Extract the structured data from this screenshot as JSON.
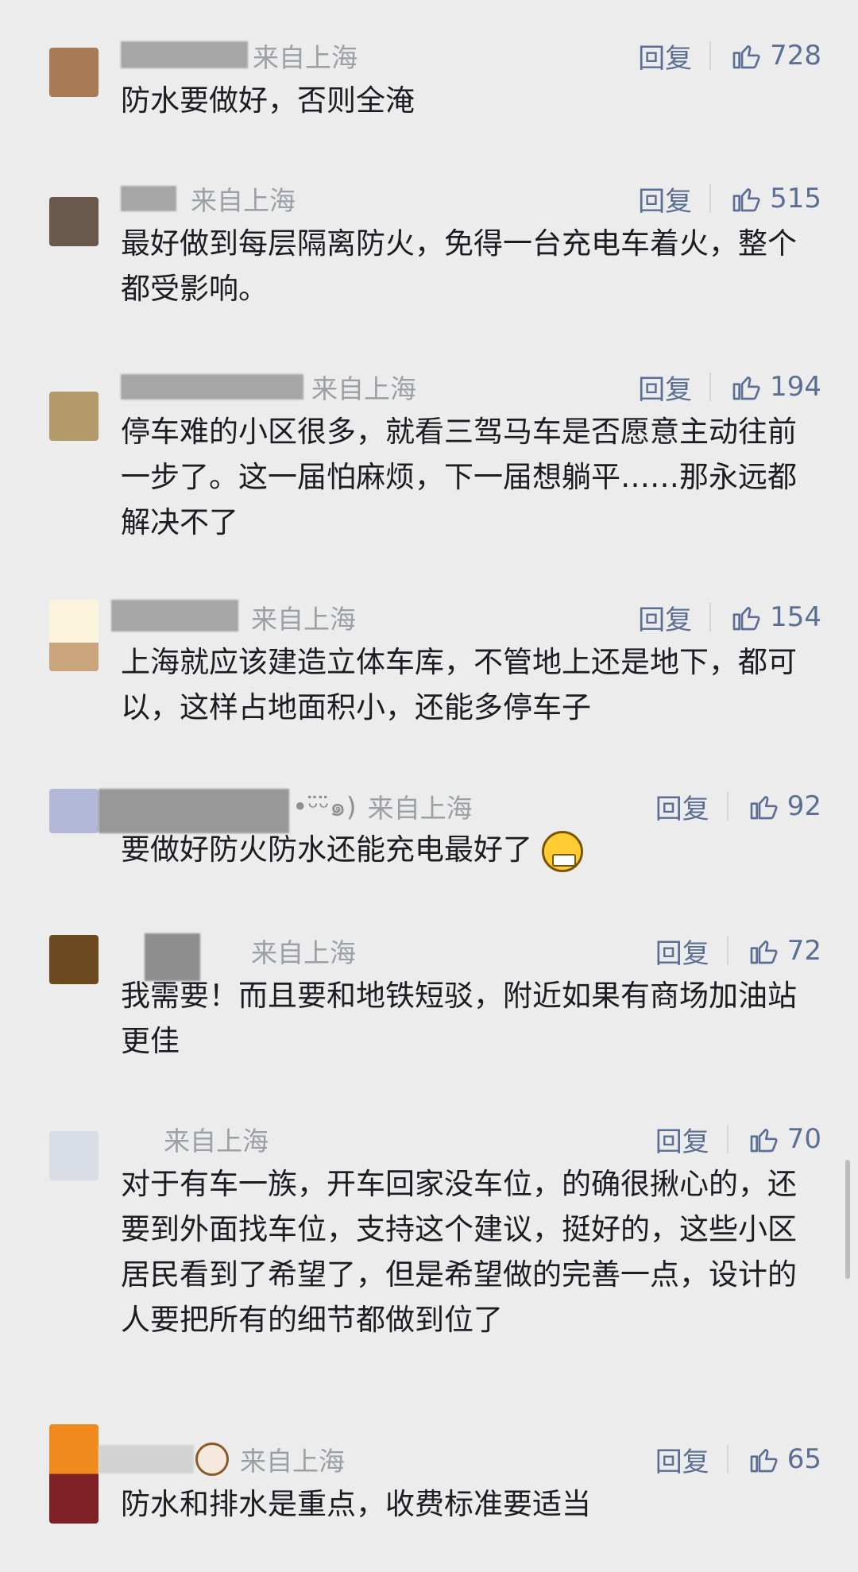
{
  "reply_label": "回复",
  "location": "来自上海",
  "comments": [
    {
      "nick": "",
      "likes": "728",
      "text": "防水要做好，否则全淹",
      "avatar_color": "#a97b55"
    },
    {
      "nick": "",
      "likes": "515",
      "text": "最好做到每层隔离防火，免得一台充电车着火，整个都受影响。",
      "avatar_color": "#6b5a4c"
    },
    {
      "nick": "",
      "likes": "194",
      "text": "停车难的小区很多，就看三驾马车是否愿意主动往前一步了。这一届怕麻烦，下一届想躺平……那永远都解决不了",
      "avatar_color": "#b39a6b"
    },
    {
      "nick": "",
      "likes": "154",
      "text": "上海就应该建造立体车库，不管地上还是地下，都可以，这样占地面积小，还能多停车子",
      "avatar_color": "#f5ead0"
    },
    {
      "nick": "•ᵕ̈ᵕ̈๑)",
      "likes": "92",
      "text": "要做好防火防水还能充电最好了",
      "avatar_color": "#b3b8d8"
    },
    {
      "nick": "",
      "likes": "72",
      "text": "我需要！而且要和地铁短驳，附近如果有商场加油站更佳",
      "avatar_color": "#6b4a1f"
    },
    {
      "nick": "",
      "likes": "70",
      "text": "对于有车一族，开车回家没车位，的确很揪心的，还要到外面找车位，支持这个建议，挺好的，这些小区居民看到了希望了，但是希望做的完善一点，设计的人要把所有的细节都做到位了",
      "avatar_color": "#d8dde6"
    },
    {
      "nick": "",
      "likes": "65",
      "text": "防水和排水是重点，收费标准要适当",
      "avatar_color": "#f08a1c"
    }
  ],
  "icons": {
    "like": "thumbs-up-icon",
    "reply_sep": "divider"
  }
}
